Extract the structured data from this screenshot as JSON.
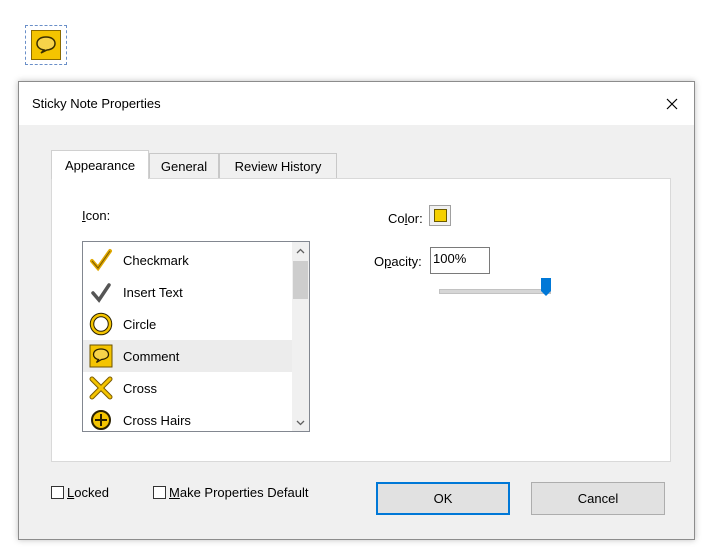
{
  "dialog": {
    "title": "Sticky Note Properties"
  },
  "tabs": [
    {
      "label": "Appearance",
      "active": true
    },
    {
      "label": "General",
      "active": false
    },
    {
      "label": "Review History",
      "active": false
    }
  ],
  "appearance": {
    "icon_label_key": "I",
    "icon_label_rest": "con:",
    "icon_list": [
      {
        "label": "Checkmark",
        "icon": "checkmark-icon",
        "selected": false
      },
      {
        "label": "Insert Text",
        "icon": "insert-text-icon",
        "selected": false
      },
      {
        "label": "Circle",
        "icon": "circle-icon",
        "selected": false
      },
      {
        "label": "Comment",
        "icon": "comment-icon",
        "selected": true
      },
      {
        "label": "Cross",
        "icon": "cross-icon",
        "selected": false
      },
      {
        "label": "Cross Hairs",
        "icon": "cross-hairs-icon",
        "selected": false
      }
    ],
    "color_label_pre": "Co",
    "color_label_key": "l",
    "color_label_post": "or:",
    "color_value": "#f5d000",
    "opacity_label_pre": "O",
    "opacity_label_key": "p",
    "opacity_label_post": "acity:",
    "opacity_value": "100%",
    "opacity_slider_fraction": 1.0
  },
  "footer": {
    "locked_key": "L",
    "locked_rest": "ocked",
    "make_default_key": "M",
    "make_default_rest": "ake Properties Default",
    "ok_label": "OK",
    "cancel_label": "Cancel"
  },
  "colors": {
    "accent": "#0078d7",
    "note_yellow": "#f4c400"
  }
}
